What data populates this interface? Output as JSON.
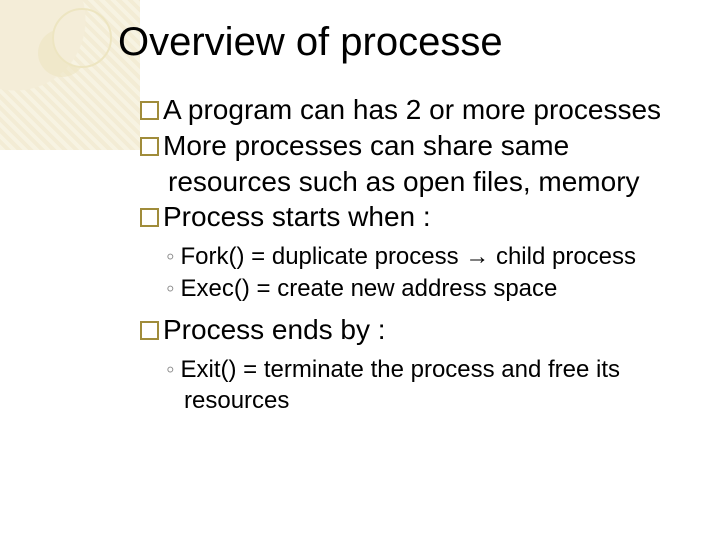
{
  "title": "Overview of processe",
  "bullets": [
    {
      "text": "A program can has 2 or more processes"
    },
    {
      "text": "More processes can share same resources such as open files, memory"
    },
    {
      "text": "Process starts when :"
    }
  ],
  "sub1": [
    {
      "text": "Fork() = duplicate process → child process"
    },
    {
      "text": "Exec() = create new address space"
    }
  ],
  "bullet4": {
    "text": "Process ends by :"
  },
  "sub2": [
    {
      "text": "Exit() = terminate the process and free its resources"
    }
  ]
}
